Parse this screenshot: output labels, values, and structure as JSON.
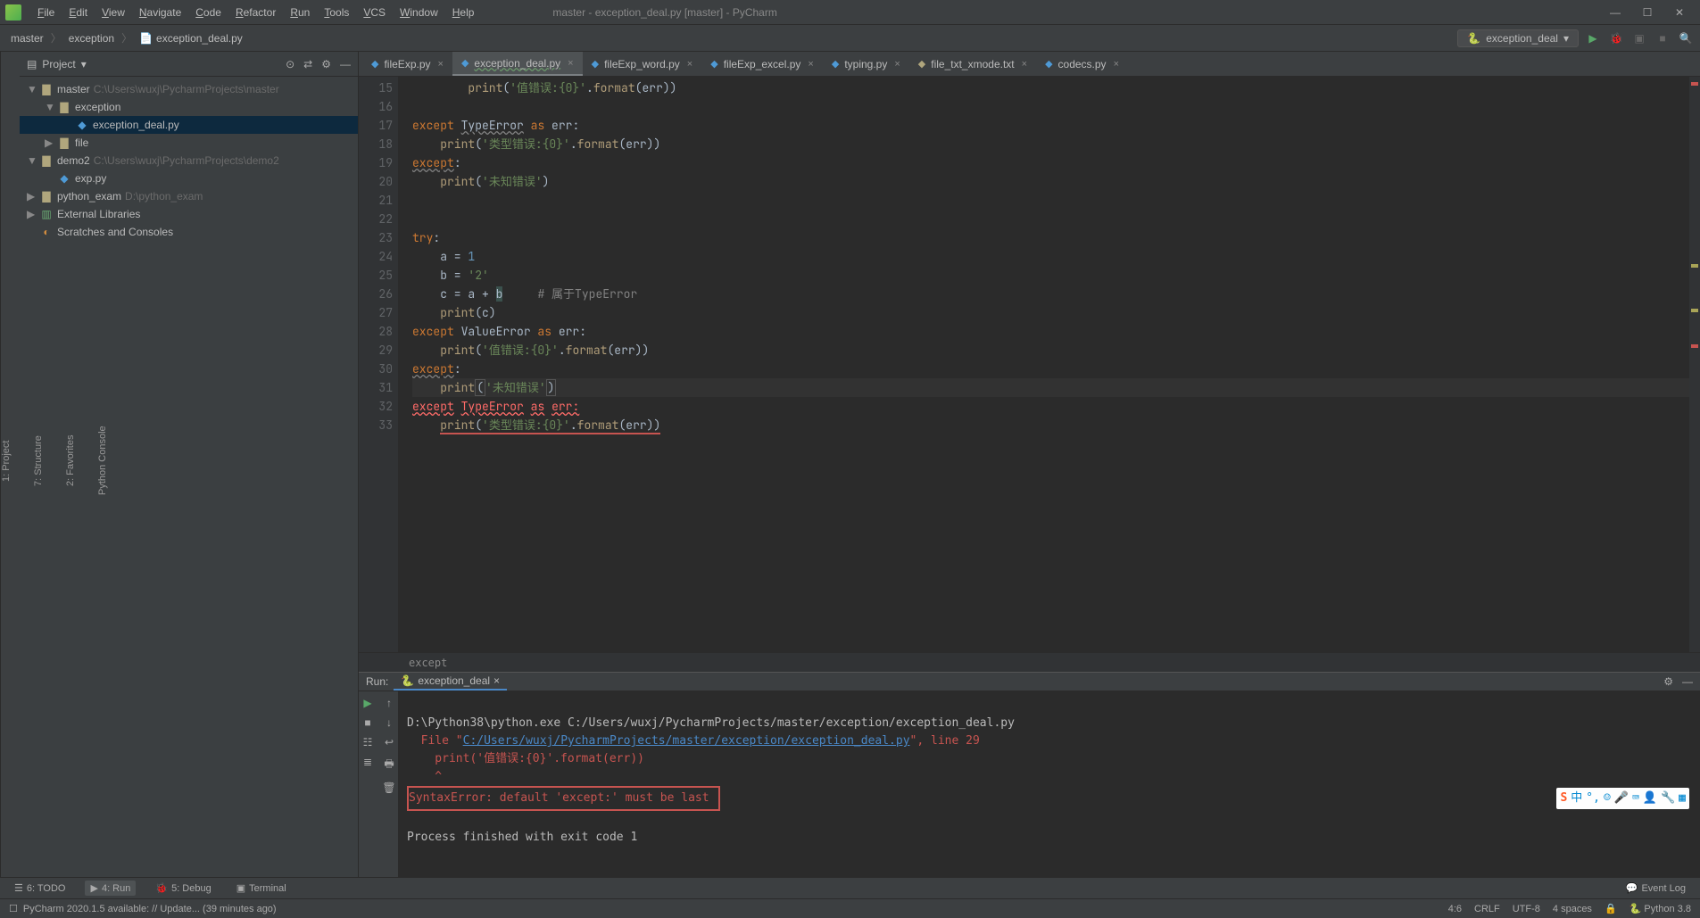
{
  "window": {
    "title": "master - exception_deal.py [master] - PyCharm"
  },
  "menu": {
    "items": [
      "File",
      "Edit",
      "View",
      "Navigate",
      "Code",
      "Refactor",
      "Run",
      "Tools",
      "VCS",
      "Window",
      "Help"
    ]
  },
  "breadcrumbs": {
    "items": [
      "master",
      "exception",
      "exception_deal.py"
    ]
  },
  "run_config": {
    "name": "exception_deal"
  },
  "project": {
    "title": "Project",
    "tree": [
      {
        "depth": 0,
        "arrow": "▼",
        "icon": "folder",
        "label": "master",
        "hint": "C:\\Users\\wuxj\\PycharmProjects\\master"
      },
      {
        "depth": 1,
        "arrow": "▼",
        "icon": "folder",
        "label": "exception",
        "hint": ""
      },
      {
        "depth": 2,
        "arrow": "",
        "icon": "python",
        "label": "exception_deal.py",
        "hint": "",
        "selected": true
      },
      {
        "depth": 1,
        "arrow": "▶",
        "icon": "folder",
        "label": "file",
        "hint": ""
      },
      {
        "depth": 0,
        "arrow": "▼",
        "icon": "folder",
        "label": "demo2",
        "hint": "C:\\Users\\wuxj\\PycharmProjects\\demo2"
      },
      {
        "depth": 1,
        "arrow": "",
        "icon": "python",
        "label": "exp.py",
        "hint": ""
      },
      {
        "depth": 0,
        "arrow": "▶",
        "icon": "folder",
        "label": "python_exam",
        "hint": "D:\\python_exam"
      },
      {
        "depth": 0,
        "arrow": "▶",
        "icon": "lib",
        "label": "External Libraries",
        "hint": ""
      },
      {
        "depth": 0,
        "arrow": "",
        "icon": "scratch",
        "label": "Scratches and Consoles",
        "hint": ""
      }
    ]
  },
  "tabs": [
    {
      "label": "fileExp.py",
      "active": false
    },
    {
      "label": "exception_deal.py",
      "active": true
    },
    {
      "label": "fileExp_word.py",
      "active": false
    },
    {
      "label": "fileExp_excel.py",
      "active": false
    },
    {
      "label": "typing.py",
      "active": false
    },
    {
      "label": "file_txt_xmode.txt",
      "active": false,
      "icon": "txt"
    },
    {
      "label": "codecs.py",
      "active": false
    }
  ],
  "editor": {
    "first_line": 15,
    "lines": [
      {
        "html": "        <span class='fn'>print</span>(<span class='str'>'值错误:{0}'</span>.<span class='fn'>format</span>(err))"
      },
      {
        "html": ""
      },
      {
        "html": "<span class='kw'>except</span> <span class='ul'>TypeError</span> <span class='kw'>as</span> err:"
      },
      {
        "html": "    <span class='fn'>print</span>(<span class='str'>'类型错误:{0}'</span>.<span class='fn'>format</span>(err))"
      },
      {
        "html": "<span class='kw ul'>except</span>:"
      },
      {
        "html": "    <span class='fn'>print</span>(<span class='str'>'未知错误'</span>)"
      },
      {
        "html": ""
      },
      {
        "html": ""
      },
      {
        "html": "<span class='kw'>try</span>:"
      },
      {
        "html": "    a = <span style='color:#6897bb'>1</span>"
      },
      {
        "html": "    b = <span class='str'>'2'</span>"
      },
      {
        "html": "    c = a + <span style='background:#3b514d'>b</span>     <span class='cmt'># 属于TypeError</span>"
      },
      {
        "html": "    <span class='fn'>print</span>(c)"
      },
      {
        "html": "<span class='kw'>except</span> ValueError <span class='kw'>as</span> err:"
      },
      {
        "html": "    <span class='fn'>print</span>(<span class='str'>'值错误:{0}'</span>.<span class='fn'>format</span>(err))"
      },
      {
        "html": "<span class='kw ul'>except</span>:"
      },
      {
        "html": "<span class='hlline'>    <span class='fn'>print</span><span class='caret-box'>(</span><span class='str'>'未知错误'</span><span class='caret-box'>)</span></span>"
      },
      {
        "html": "<span class='kw err'>except</span> <span class='err'>TypeError</span> <span class='kw err'>as</span> <span class='err'>err:</span>"
      },
      {
        "html": "    <span class='fn red-ul'>print</span><span class='red-ul'>(</span><span class='str red-ul'>'类型错误:{0}'</span><span class='red-ul'>.</span><span class='fn red-ul'>format</span><span class='red-ul'>(err))</span>"
      }
    ],
    "breadcrumb": "except"
  },
  "run": {
    "title": "Run:",
    "tab": "exception_deal",
    "output": {
      "cmd": "D:\\Python38\\python.exe C:/Users/wuxj/PycharmProjects/master/exception/exception_deal.py",
      "file_prefix": "  File \"",
      "file_link": "C:/Users/wuxj/PycharmProjects/master/exception/exception_deal.py",
      "file_suffix": "\", line 29",
      "code_line": "    print('值错误:{0}'.format(err))",
      "caret": "    ^",
      "error": "SyntaxError: default 'except:' must be last",
      "exit": "Process finished with exit code 1"
    }
  },
  "leftbar_labels": {
    "project": "1: Project",
    "structure": "7: Structure",
    "favorites": "2: Favorites",
    "console": "Python Console"
  },
  "toolwindows": {
    "todo": "6: TODO",
    "run": "4: Run",
    "debug": "5: Debug",
    "terminal": "Terminal",
    "eventlog": "Event Log"
  },
  "statusbar": {
    "message": "PyCharm 2020.1.5 available: // Update... (39 minutes ago)",
    "pos": "4:6",
    "eol": "CRLF",
    "encoding": "UTF-8",
    "indent": "4 spaces",
    "interpreter": "Python 3.8"
  },
  "colors": {
    "bg": "#3c3f41",
    "editor_bg": "#2b2b2b",
    "accent_green": "#59a869",
    "accent_blue": "#4a88c7",
    "error": "#c75450"
  }
}
